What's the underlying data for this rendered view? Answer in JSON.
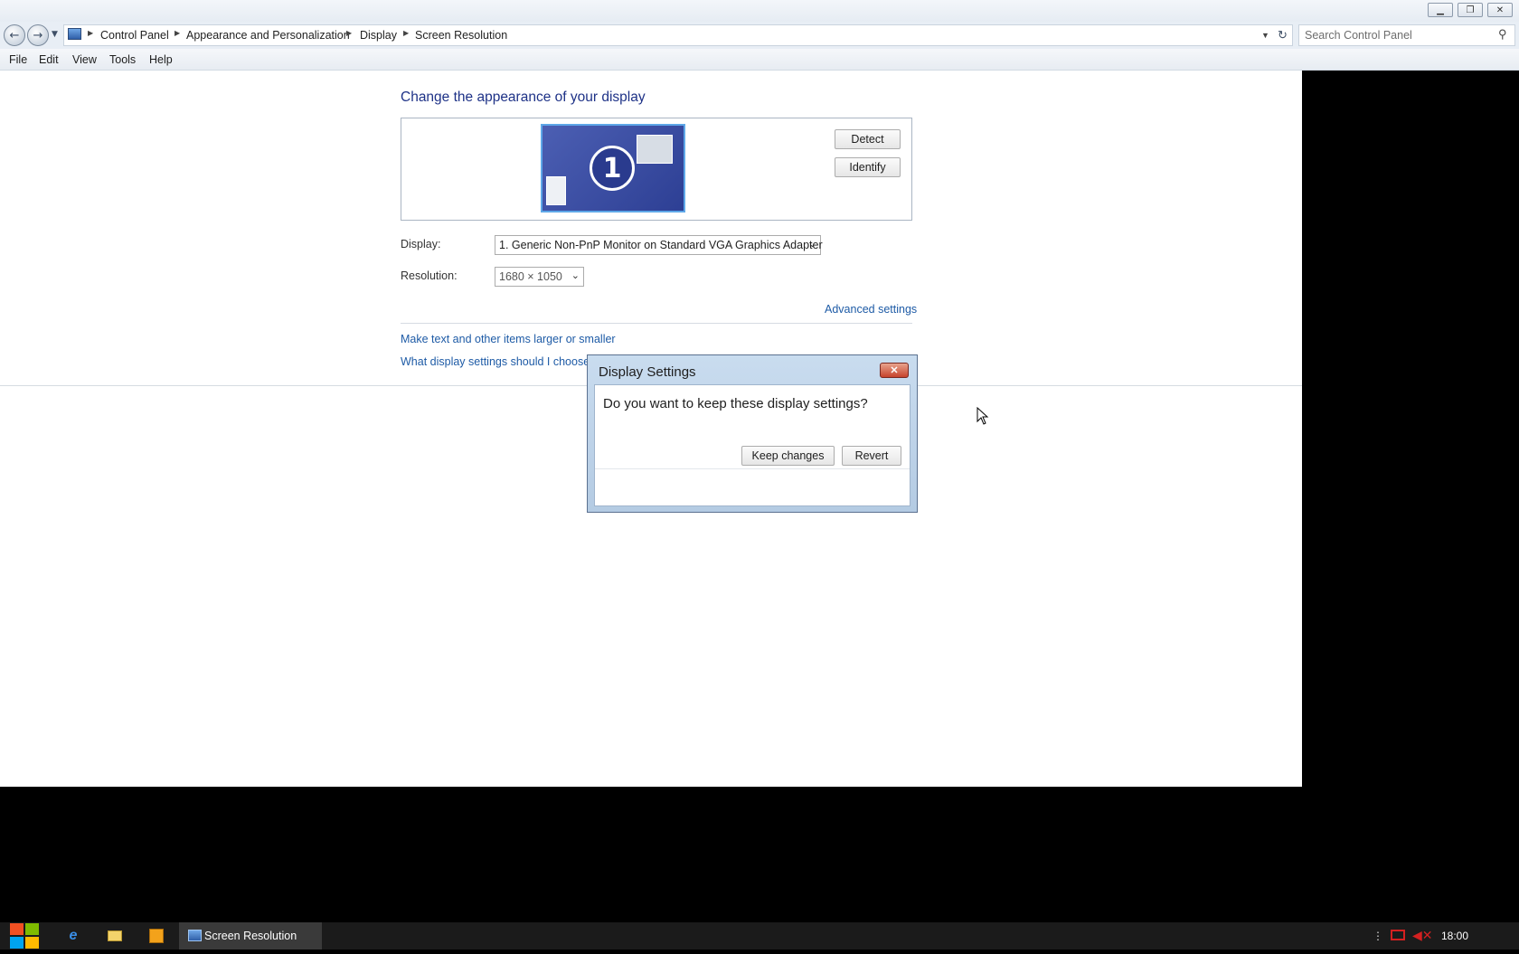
{
  "window": {
    "controls": [
      "minimize",
      "restore",
      "close"
    ],
    "breadcrumbs": [
      "Control Panel",
      "Appearance and Personalization",
      "Display",
      "Screen Resolution"
    ],
    "search_placeholder": "Search Control Panel"
  },
  "menu": [
    "File",
    "Edit",
    "View",
    "Tools",
    "Help"
  ],
  "content": {
    "heading": "Change the appearance of your display",
    "monitor_number": "1",
    "detect_label": "Detect",
    "identify_label": "Identify",
    "display_label": "Display:",
    "display_value": "1. Generic Non-PnP Monitor on Standard VGA Graphics Adapter",
    "resolution_label": "Resolution:",
    "resolution_value": "1680 × 1050",
    "advanced_link": "Advanced settings",
    "text_size_link": "Make text and other items larger or smaller",
    "help_link": "What display settings should I choose?"
  },
  "dialog": {
    "title": "Display Settings",
    "question": "Do you want to keep these display settings?",
    "keep_label": "Keep changes",
    "revert_label": "Revert"
  },
  "taskbar": {
    "task_label": "Screen Resolution",
    "clock": "18:00"
  },
  "colors": {
    "heading": "#1e3287",
    "link": "#1e5ba6",
    "taskbar": "#1b1b1b"
  }
}
